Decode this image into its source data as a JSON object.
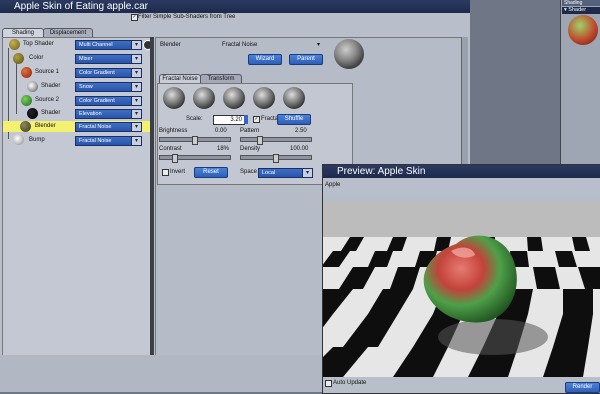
{
  "window": {
    "title": "Apple Skin of Eating apple.car"
  },
  "filter": {
    "label": "Filter Simple Sub-Shaders from Tree",
    "checked": true
  },
  "tabs": {
    "shading": "Shading",
    "displacement": "Displacement"
  },
  "tree": {
    "top": {
      "label": "Top Shader",
      "value": "Multi Channel"
    },
    "color": {
      "label": "Color",
      "value": "Mixer"
    },
    "source1": {
      "label": "Source 1",
      "value": "Color Gradient"
    },
    "shader1": {
      "label": "Shader",
      "value": "Snow"
    },
    "source2": {
      "label": "Source 2",
      "value": "Color Gradient"
    },
    "shader2": {
      "label": "Shader",
      "value": "Elevation"
    },
    "blender": {
      "label": "Blender",
      "value": "Fractal Noise"
    },
    "bump": {
      "label": "Bump",
      "value": "Fractal Noise"
    }
  },
  "editor": {
    "name": "Blender",
    "type": "Fractal Noise",
    "wizard": "Wizard",
    "parent": "Parent",
    "tab_fractal": "Fractal Noise",
    "tab_transform": "Transform",
    "scale_label": "Scale:",
    "scale_value": "3.20",
    "fractal_label": "Fractal",
    "fractal_checked": true,
    "shuffle": "Shuffle",
    "brightness_label": "Brightness",
    "brightness_value": "0.00",
    "brightness_level": 0.5,
    "pattern_label": "Pattern",
    "pattern_value": "2.50",
    "pattern_level": 0.25,
    "contrast_label": "Contrast",
    "contrast_value": "18%",
    "contrast_level": 0.18,
    "density_label": "Density",
    "density_value": "100.00",
    "density_level": 0.5,
    "invert_label": "Invert",
    "reset": "Reset",
    "space_label": "Space",
    "space_value": "Local"
  },
  "right_panel": {
    "tab_top": "Shading",
    "tab_shader": "Shader"
  },
  "preview": {
    "title": "Preview: Apple Skin",
    "object": "Apple",
    "auto_update": "Auto Update",
    "render": "Render"
  },
  "colors": {
    "accent": "#2f62c4",
    "highlight": "#f4f070",
    "titlebar": "#24335a"
  }
}
